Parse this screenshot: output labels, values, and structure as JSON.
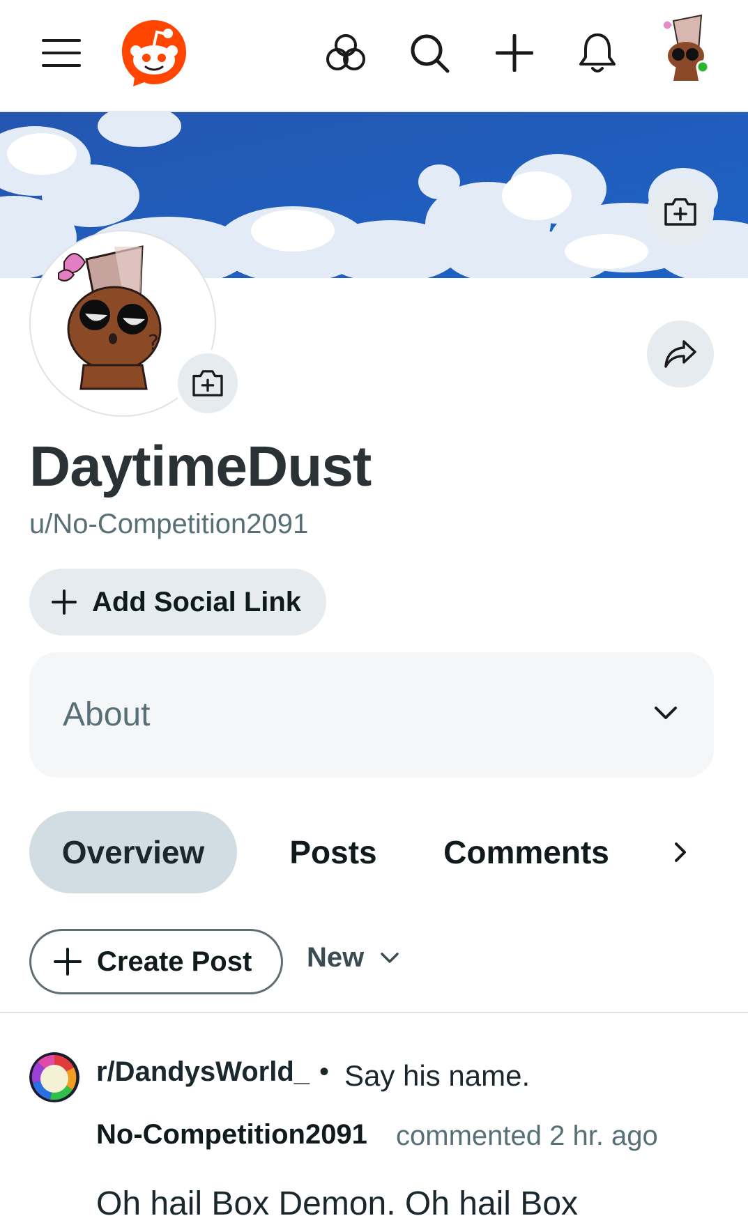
{
  "profile": {
    "display_name": "DaytimeDust",
    "username": "u/No-Competition2091",
    "add_social_label": "Add Social Link",
    "about_label": "About"
  },
  "tabs": [
    {
      "label": "Overview",
      "active": true
    },
    {
      "label": "Posts",
      "active": false
    },
    {
      "label": "Comments",
      "active": false
    }
  ],
  "actions": {
    "create_post_label": "Create Post",
    "sort_label": "New"
  },
  "post": {
    "subreddit": "r/DandysWorld_",
    "separator": "•",
    "title": "Say his name.",
    "author": "No-Competition2091",
    "meta": "commented 2 hr. ago",
    "body": "Oh hail Box Demon. Oh hail Box"
  },
  "icons": {
    "menu": "hamburger-menu-icon",
    "logo": "reddit-logo",
    "communities": "communities-icon",
    "search": "search-icon",
    "create": "plus-icon",
    "notifications": "bell-icon",
    "banner_upload": "camera-add-icon",
    "share": "share-icon",
    "avatar_upload": "camera-add-icon",
    "expand": "chevron-down-icon",
    "tabs_next": "chevron-right-icon",
    "sort": "chevron-down-icon"
  },
  "colors": {
    "brand": "#ff4500",
    "online": "#2cb431",
    "active_tab": "#d2dde3",
    "chip": "#e5ebee"
  }
}
